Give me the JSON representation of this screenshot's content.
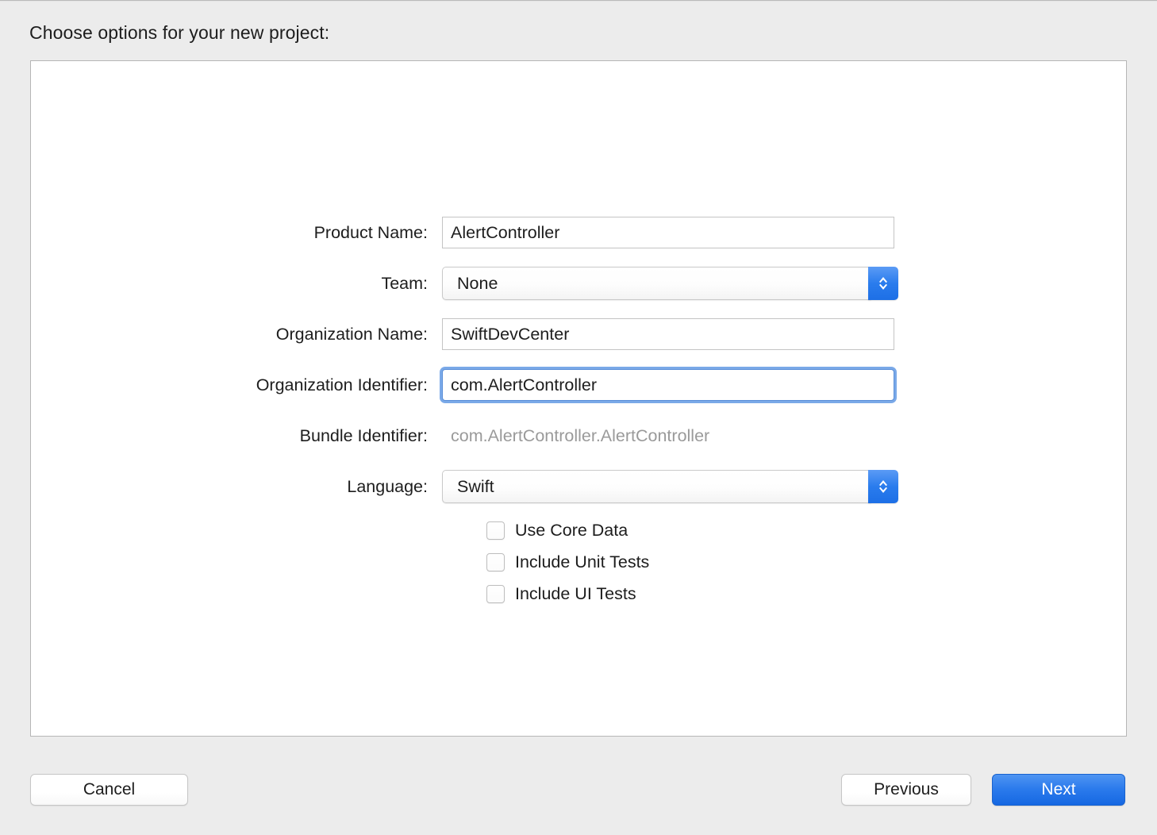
{
  "dialog": {
    "title": "Choose options for your new project:"
  },
  "form": {
    "fields": [
      {
        "label": "Product Name:",
        "value": "AlertController",
        "type": "text"
      },
      {
        "label": "Team:",
        "value": "None",
        "type": "popup"
      },
      {
        "label": "Organization Name:",
        "value": "SwiftDevCenter",
        "type": "text"
      },
      {
        "label": "Organization Identifier:",
        "value": "com.AlertController",
        "type": "text-focused"
      },
      {
        "label": "Bundle Identifier:",
        "value": "com.AlertController.AlertController",
        "type": "static"
      },
      {
        "label": "Language:",
        "value": "Swift",
        "type": "popup"
      }
    ],
    "checkboxes": [
      {
        "label": "Use Core Data",
        "checked": false
      },
      {
        "label": "Include Unit Tests",
        "checked": false
      },
      {
        "label": "Include UI Tests",
        "checked": false
      }
    ]
  },
  "footer": {
    "cancel_label": "Cancel",
    "previous_label": "Previous",
    "next_label": "Next"
  },
  "colors": {
    "accent_blue": "#2a7aec",
    "focus_ring": "#7aa9e8",
    "window_background": "#ececec",
    "panel_background": "#ffffff",
    "panel_border": "#b6b6b6",
    "static_text": "#9a9a9a"
  },
  "icons": {
    "stepper": "chevron-up-down-icon"
  }
}
